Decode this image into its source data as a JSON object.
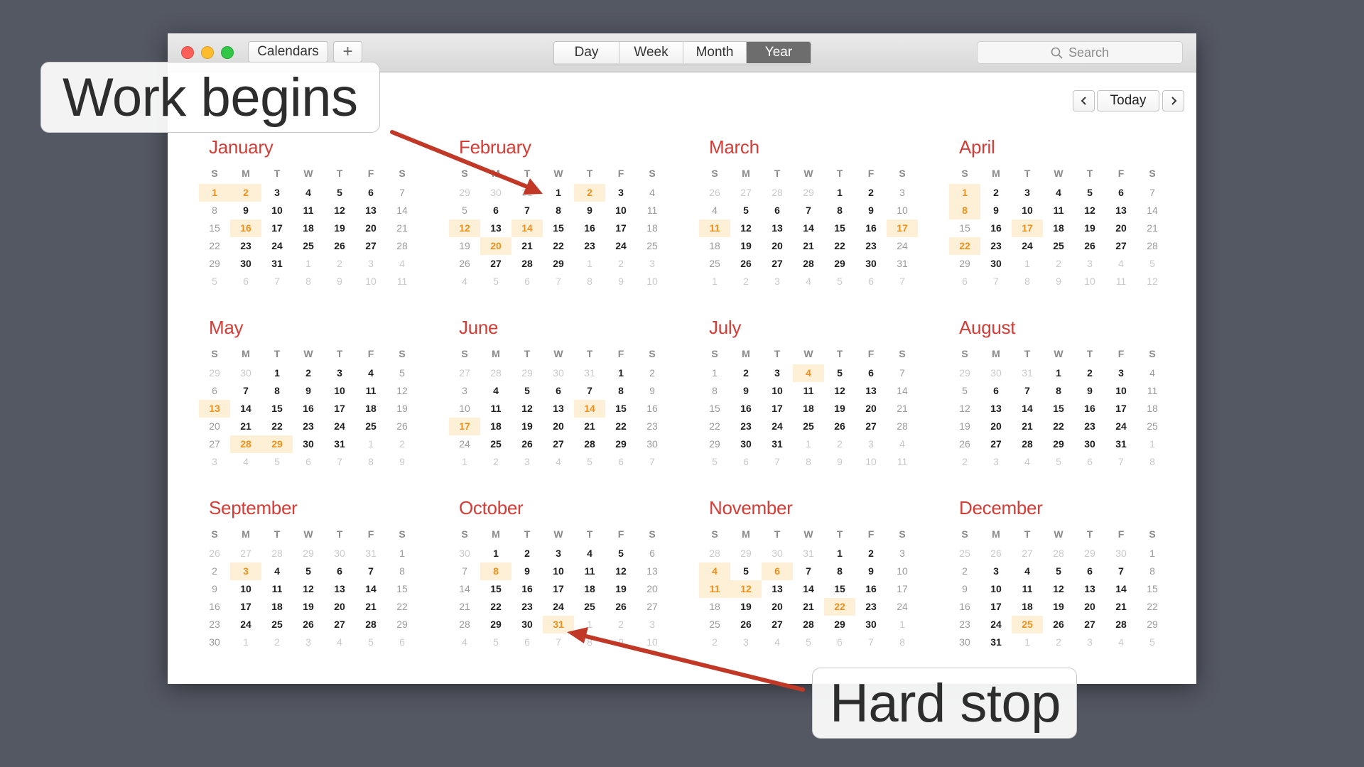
{
  "toolbar": {
    "calendars_label": "Calendars",
    "add_label": "+",
    "views": [
      "Day",
      "Week",
      "Month",
      "Year"
    ],
    "active_view": "Year",
    "search_placeholder": "Search"
  },
  "nav": {
    "prev": "‹",
    "today": "Today",
    "next": "›"
  },
  "dow": [
    "S",
    "M",
    "T",
    "W",
    "T",
    "F",
    "S"
  ],
  "colors": {
    "month_name": "#d53c36",
    "highlight_bg": "#fdf0d7",
    "highlight_text": "#f0901c"
  },
  "months": [
    {
      "name": "January",
      "lead": [],
      "count": 31,
      "trail": [
        1,
        2,
        3,
        4,
        5,
        6,
        7,
        8,
        9,
        10,
        11
      ],
      "highlights": [
        1,
        2,
        16
      ]
    },
    {
      "name": "February",
      "lead": [
        29,
        30,
        31
      ],
      "count": 29,
      "trail": [
        1,
        2,
        3,
        4,
        5,
        6,
        7,
        8,
        9,
        10
      ],
      "highlights": [
        2,
        12,
        14,
        20
      ]
    },
    {
      "name": "March",
      "lead": [
        26,
        27,
        28,
        29
      ],
      "count": 31,
      "trail": [
        1,
        2,
        3,
        4,
        5,
        6,
        7
      ],
      "highlights": [
        11,
        17
      ]
    },
    {
      "name": "April",
      "lead": [],
      "count": 30,
      "trail": [
        1,
        2,
        3,
        4,
        5,
        6,
        7,
        8,
        9,
        10,
        11,
        12
      ],
      "highlights": [
        1,
        8,
        17,
        22
      ]
    },
    {
      "name": "May",
      "lead": [
        29,
        30
      ],
      "count": 31,
      "trail": [
        1,
        2,
        3,
        4,
        5,
        6,
        7,
        8,
        9
      ],
      "highlights": [
        13,
        28,
        29
      ]
    },
    {
      "name": "June",
      "lead": [
        27,
        28,
        29,
        30,
        31
      ],
      "count": 30,
      "trail": [
        1,
        2,
        3,
        4,
        5,
        6,
        7
      ],
      "highlights": [
        14,
        17
      ]
    },
    {
      "name": "July",
      "lead": [],
      "count": 31,
      "trail": [
        1,
        2,
        3,
        4,
        5,
        6,
        7,
        8,
        9,
        10,
        11
      ],
      "highlights": [
        4
      ]
    },
    {
      "name": "August",
      "lead": [
        29,
        30,
        31
      ],
      "count": 31,
      "trail": [
        1,
        2,
        3,
        4,
        5,
        6,
        7,
        8
      ],
      "highlights": []
    },
    {
      "name": "September",
      "lead": [
        26,
        27,
        28,
        29,
        30,
        31
      ],
      "count": 30,
      "trail": [
        1,
        2,
        3,
        4,
        5,
        6
      ],
      "highlights": [
        3
      ]
    },
    {
      "name": "October",
      "lead": [
        30
      ],
      "count": 31,
      "trail": [
        1,
        2,
        3,
        4,
        5,
        6,
        7,
        8,
        9,
        10
      ],
      "highlights": [
        8,
        31
      ]
    },
    {
      "name": "November",
      "lead": [
        28,
        29,
        30,
        31
      ],
      "count": 30,
      "trail": [
        1,
        2,
        3,
        4,
        5,
        6,
        7,
        8
      ],
      "highlights": [
        4,
        6,
        11,
        12,
        22
      ]
    },
    {
      "name": "December",
      "lead": [
        25,
        26,
        27,
        28,
        29,
        30
      ],
      "count": 31,
      "trail": [
        1,
        2,
        3,
        4,
        5
      ],
      "highlights": [
        25
      ]
    }
  ],
  "callouts": {
    "work_begins": "Work begins",
    "hard_stop": "Hard stop"
  }
}
